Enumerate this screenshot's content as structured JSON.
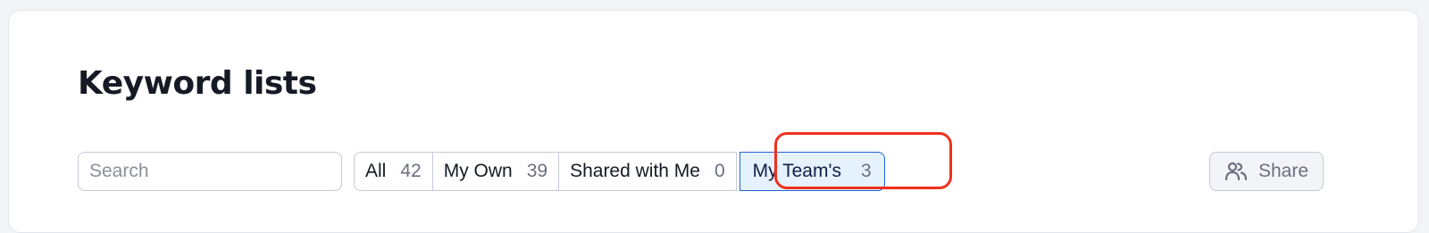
{
  "page": {
    "title": "Keyword lists"
  },
  "search": {
    "placeholder": "Search",
    "icon": "search-icon"
  },
  "tabs": [
    {
      "label": "All",
      "count": "42",
      "active": false
    },
    {
      "label": "My Own",
      "count": "39",
      "active": false
    },
    {
      "label": "Shared with Me",
      "count": "0",
      "active": false
    },
    {
      "label": "My Team's",
      "count": "3",
      "active": true
    }
  ],
  "share": {
    "label": "Share",
    "icon": "users-icon"
  },
  "colors": {
    "active_tab_bg": "#e6f1fe",
    "active_tab_border": "#1f64d4",
    "highlight": "#f0311d"
  }
}
